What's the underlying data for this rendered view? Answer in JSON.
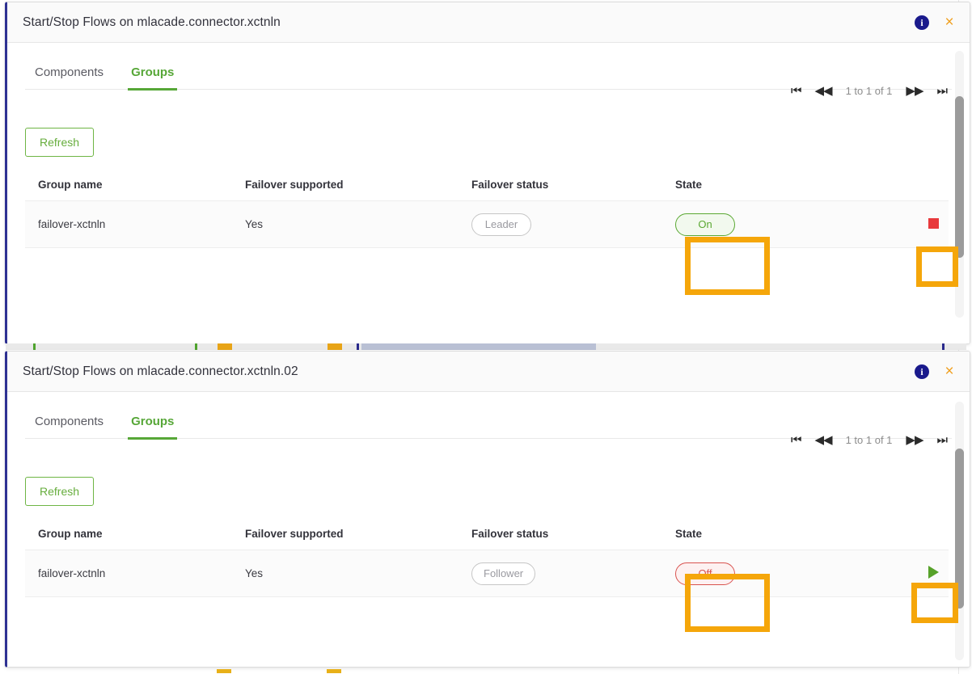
{
  "colors": {
    "accent_green": "#57a738",
    "highlight_orange": "#f5a60a",
    "info_blue": "#1a1a8c",
    "close_orange": "#f0a020",
    "state_on": "#5aa832",
    "state_off": "#d9534f",
    "stop_red": "#e8393c",
    "play_green": "#57a22a",
    "dialog_left_border": "#2e3192"
  },
  "panels": [
    {
      "title": "Start/Stop Flows on mlacade.connector.xctnln",
      "info_icon": "info-icon",
      "close_icon": "close-icon",
      "tabs": [
        {
          "label": "Components",
          "active": false
        },
        {
          "label": "Groups",
          "active": true
        }
      ],
      "pager": {
        "first_icon": "first-page-icon",
        "prev_icon": "previous-page-icon",
        "label": "1 to 1 of 1",
        "next_icon": "next-page-icon",
        "last_icon": "last-page-icon"
      },
      "refresh_label": "Refresh",
      "table": {
        "headers": [
          "Group name",
          "Failover supported",
          "Failover status",
          "State"
        ],
        "rows": [
          {
            "group_name": "failover-xctnln",
            "failover_supported": "Yes",
            "failover_status": "Leader",
            "state": "On",
            "action_icon": "stop-icon"
          }
        ]
      }
    },
    {
      "title": "Start/Stop Flows on mlacade.connector.xctnln.02",
      "info_icon": "info-icon",
      "close_icon": "close-icon",
      "tabs": [
        {
          "label": "Components",
          "active": false
        },
        {
          "label": "Groups",
          "active": true
        }
      ],
      "pager": {
        "first_icon": "first-page-icon",
        "prev_icon": "previous-page-icon",
        "label": "1 to 1 of 1",
        "next_icon": "next-page-icon",
        "last_icon": "last-page-icon"
      },
      "refresh_label": "Refresh",
      "table": {
        "headers": [
          "Group name",
          "Failover supported",
          "Failover status",
          "State"
        ],
        "rows": [
          {
            "group_name": "failover-xctnln",
            "failover_supported": "Yes",
            "failover_status": "Follower",
            "state": "Off",
            "action_icon": "play-icon"
          }
        ]
      }
    }
  ],
  "glyphs": {
    "first": "⏮",
    "prev": "◀◀",
    "next": "▶▶",
    "last": "⏭",
    "info": "i",
    "close": "×"
  }
}
